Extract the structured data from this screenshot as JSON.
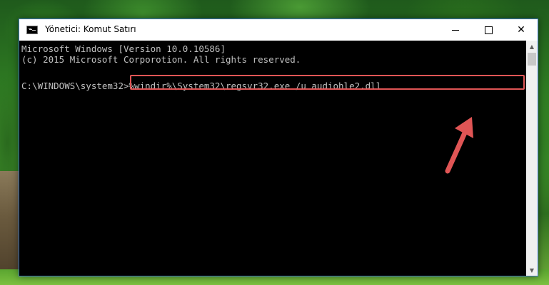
{
  "window": {
    "title": "Yönetici: Komut Satırı",
    "controls": {
      "minimize": "minimize-icon",
      "maximize": "maximize-icon",
      "close": "✕"
    }
  },
  "console": {
    "lines": [
      "Microsoft Windows [Version 10.0.10586]",
      "(c) 2015 Microsoft Corporotion. All rights reserved."
    ],
    "prompt": "C:\\WINDOWS\\system32>",
    "command": "%windir%\\System32\\regsvr32.exe /u audiohle2.dll"
  },
  "annotation": {
    "highlight_color": "#e05555",
    "arrow_color": "#e05555"
  },
  "scrollbar": {
    "up_icon": "▲",
    "down_icon": "▼"
  }
}
